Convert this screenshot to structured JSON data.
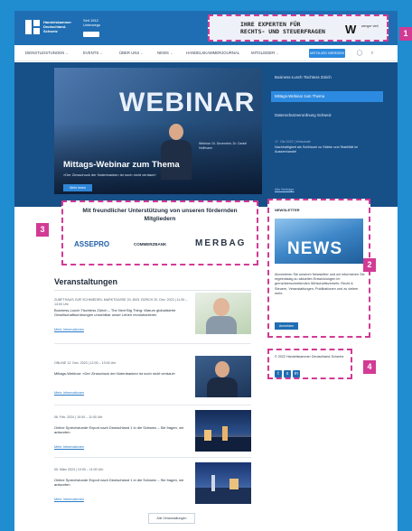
{
  "header": {
    "org_name": "Handelskammer Deutschland-Schweiz",
    "org_sub": "Seit 1912 Unterwegs",
    "ad": {
      "line1": "IHRE EXPERTEN FÜR",
      "line2": "RECHTS- UND STEUERFRAGEN",
      "logo": "W",
      "logo_sub": "wenger vieli"
    }
  },
  "nav": {
    "items": [
      {
        "label": "DIENSTLEISTUNGEN",
        "has_menu": true
      },
      {
        "label": "EVENTS",
        "has_menu": true
      },
      {
        "label": "ÜBER UNS",
        "has_menu": true
      },
      {
        "label": "NEWS",
        "has_menu": true
      },
      {
        "label": "HANDELSKAMMERJOURNAL",
        "has_menu": false
      },
      {
        "label": "MITGLIEDER",
        "has_menu": true
      }
    ],
    "cta": "MITGLIED WERDEN",
    "icons": [
      "user-icon",
      "search-icon"
    ]
  },
  "hero": {
    "image_word": "WEBINAR",
    "image_note": "Webinar 10. Dezember, Dr. Daniel Hoffmann",
    "title": "Mittags-Webinar zum Thema",
    "subtitle": "«Der Zinsschock der Notenbanken ist noch nicht verdaut»",
    "button": "Mehr lesen",
    "side_items": [
      "Business-Lunch Tischtess Zürich",
      "Mittags-Webinar zum Thema",
      "Datenschutzverordnung Schweiz"
    ],
    "active_index": 1,
    "side_date": "17. Okt 2022 | Wirtschaft",
    "side_desc": "Nachhaltigkeit als Schlüssel zu Stärke und Stabilität im Aussenhandel",
    "side_link": "Alle Beiträge"
  },
  "sponsors": {
    "title": "Mit freundlicher Unterstützung von unseren fördernden Mitgliedern",
    "logos": [
      "ASSEPRO",
      "COMMERZBANK",
      "MERBAG"
    ]
  },
  "newsletter": {
    "title": "NEWSLETTER",
    "image_word": "NEWS",
    "description": "Abonnieren Sie unseren Newsletter und wir informieren Sie regelmässig zu aktuellen Entwicklungen im grenzüberschreitenden Wirtschaftsverkehr, Recht & Steuern, Veranstaltungen, Publikationen und zu vielem mehr.",
    "button": "Anmelden"
  },
  "social": {
    "copyright": "© 2022 Handelskammer Deutschland-Schweiz",
    "icons": [
      "twitter-icon",
      "xing-icon",
      "linkedin-icon"
    ]
  },
  "events": {
    "heading": "Veranstaltungen",
    "items": [
      {
        "date": "ZUNFTHAUS ZUR SCHMIEDEN, MARKTGASSE 20, 8001 ZÜRICH 20. Dez. 2023 | 11:30 – 14:00 Uhr",
        "title": "Business-Lunch Tischtess Zürich – The Next Big Thing: Warum globalisierte Gesellschaftsordnungen unsichtbar unser Leben revolutionieren",
        "link": "Mehr Informationen"
      },
      {
        "date": "ONLINE 12. Dez. 2023 | 12:00 – 13:00 Uhr",
        "title": "Mittags-Webinar: «Der Zinsschock der Notenbanken ist noch nicht verdaut»",
        "link": "Mehr Informationen"
      },
      {
        "date": "06. Feb. 2024 | 10:00 – 11:00 Uhr",
        "title": "Online Sprechstunde Export nach Deutschland 1 in die Schweiz – Sie fragen, wir antworten",
        "link": "Mehr Informationen"
      },
      {
        "date": "05. März 2024 | 10:00 – 11:00 Uhr",
        "title": "Online Sprechstunde Export nach Deutschland 1 in die Schweiz – Sie fragen, wir antworten",
        "link": "Mehr Informationen"
      }
    ],
    "more_button": "Alle Veranstaltungen"
  },
  "callouts": [
    "1",
    "2",
    "3",
    "4"
  ],
  "colors": {
    "background": "#1f8dd0",
    "header": "#1f6eb3",
    "accent": "#2c8ae0",
    "highlight": "#d23a94"
  }
}
